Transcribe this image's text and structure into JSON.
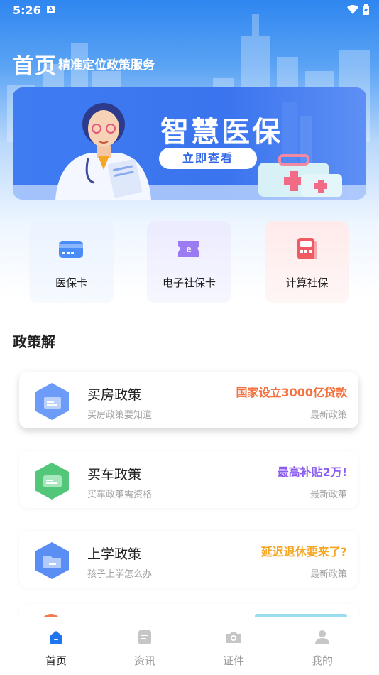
{
  "status_bar": {
    "time": "5:26",
    "notification_glyph": "A"
  },
  "header": {
    "title": "首页",
    "subtitle": "精准定位政策服务"
  },
  "banner": {
    "title": "智慧医保",
    "button_label": "立即查看"
  },
  "quick_actions": [
    {
      "label": "医保卡",
      "icon": "medical-card-icon",
      "color": "#4a8cf5"
    },
    {
      "label": "电子社保卡",
      "icon": "e-social-card-icon",
      "color": "#9b7bf2"
    },
    {
      "label": "计算社保",
      "icon": "calculator-icon",
      "color": "#f05a63"
    }
  ],
  "section": {
    "title": "政策解"
  },
  "policies": [
    {
      "title": "买房政策",
      "subtitle": "买房政策要知道",
      "tag": "国家设立3000亿贷款",
      "tag_color": "#f4703e",
      "note": "最新政策",
      "icon_color": "#6c9cf7"
    },
    {
      "title": "买车政策",
      "subtitle": "买车政策需资格",
      "tag": "最高补贴2万!",
      "tag_color": "#8a5cf0",
      "note": "最新政策",
      "icon_color": "#52c77a"
    },
    {
      "title": "上学政策",
      "subtitle": "孩子上学怎么办",
      "tag": "延迟退休要来了?",
      "tag_color": "#f5a623",
      "note": "最新政策",
      "icon_color": "#5b8ef5"
    }
  ],
  "tabbar": {
    "tabs": [
      {
        "label": "首页",
        "icon": "home-icon",
        "active": true
      },
      {
        "label": "资讯",
        "icon": "news-icon",
        "active": false
      },
      {
        "label": "证件",
        "icon": "camera-icon",
        "active": false
      },
      {
        "label": "我的",
        "icon": "profile-icon",
        "active": false
      }
    ]
  },
  "colors": {
    "primary": "#2f86f0",
    "active_tab": "#1f74f0",
    "inactive_tab": "#c6c6c6"
  }
}
